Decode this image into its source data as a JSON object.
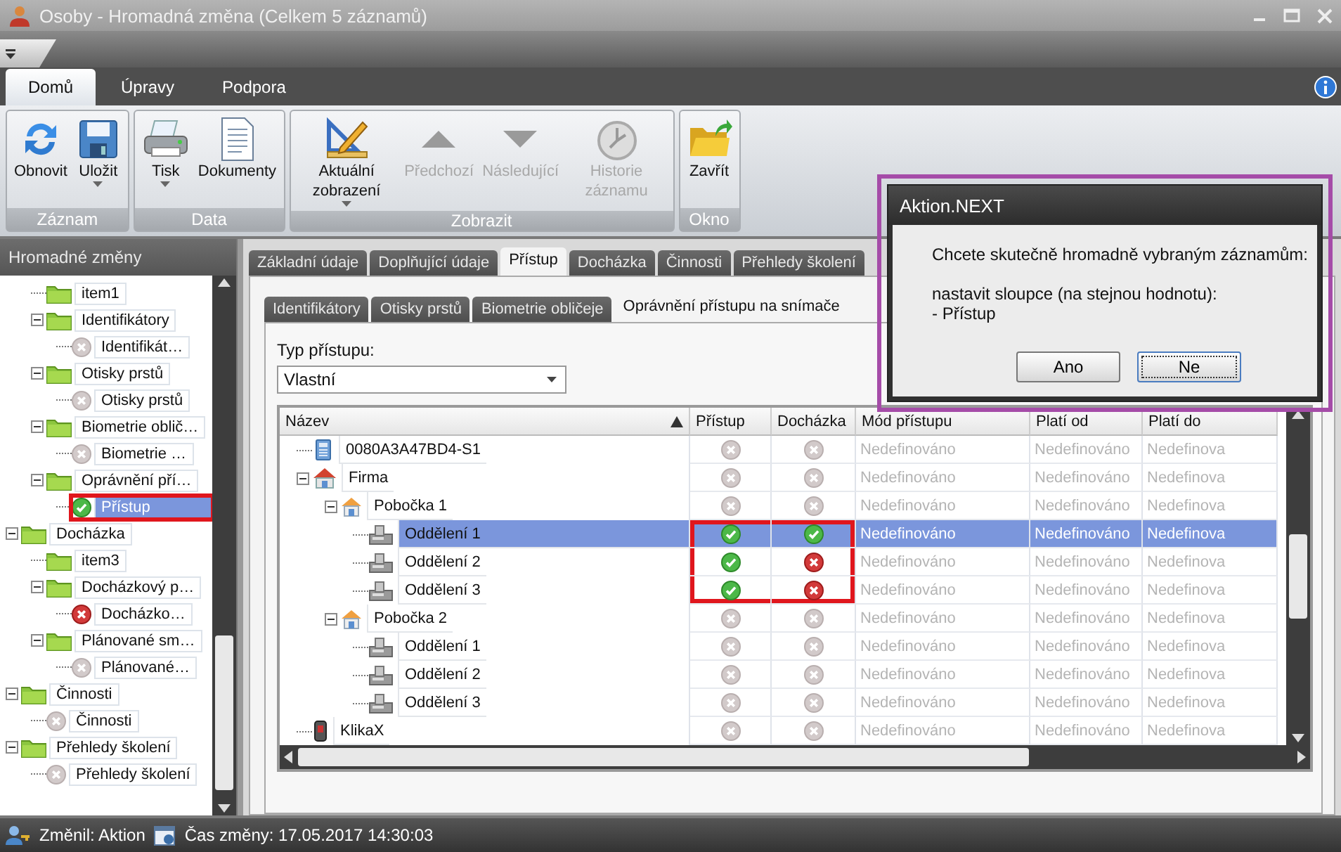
{
  "window": {
    "title": "Osoby - Hromadná změna (Celkem 5 záznamů)"
  },
  "ribbon": {
    "tabs": [
      {
        "label": "Domů",
        "selected": true
      },
      {
        "label": "Úpravy",
        "selected": false
      },
      {
        "label": "Podpora",
        "selected": false
      }
    ],
    "groups": [
      {
        "label": "Záznam",
        "buttons": [
          {
            "label": "Obnovit",
            "kind": "refresh",
            "dropdown": false,
            "disabled": false
          },
          {
            "label": "Uložit",
            "kind": "save",
            "dropdown": true,
            "disabled": false
          }
        ]
      },
      {
        "label": "Data",
        "buttons": [
          {
            "label": "Tisk",
            "kind": "print",
            "dropdown": true,
            "disabled": false
          },
          {
            "label": "Dokumenty",
            "kind": "document",
            "dropdown": false,
            "disabled": false
          }
        ]
      },
      {
        "label": "Zobrazit",
        "buttons": [
          {
            "label": "Aktuální zobrazení",
            "kind": "ruler",
            "dropdown": true,
            "disabled": false
          },
          {
            "label": "Předchozí",
            "kind": "up",
            "dropdown": false,
            "disabled": true
          },
          {
            "label": "Následující",
            "kind": "down",
            "dropdown": false,
            "disabled": true
          },
          {
            "label": "Historie záznamu",
            "kind": "clock",
            "dropdown": false,
            "disabled": true
          }
        ]
      },
      {
        "label": "Okno",
        "buttons": [
          {
            "label": "Zavřít",
            "kind": "folder",
            "dropdown": false,
            "disabled": false
          }
        ]
      }
    ]
  },
  "sidebar": {
    "title": "Hromadné změny",
    "tree": [
      {
        "children": [
          {
            "label": "item1",
            "kind": "folder",
            "selected": false
          },
          {
            "label": "Identifikátory",
            "kind": "folder",
            "selected": false,
            "expanded": true,
            "children": [
              {
                "label": "Identifikát…",
                "kind": "unset",
                "selected": false,
                "highlighted": false
              }
            ]
          },
          {
            "label": "Otisky prstů",
            "kind": "folder",
            "selected": false,
            "expanded": true,
            "children": [
              {
                "label": "Otisky prstů",
                "kind": "unset",
                "selected": false,
                "highlighted": false
              }
            ]
          },
          {
            "label": "Biometrie oblič…",
            "kind": "folder",
            "selected": false,
            "expanded": true,
            "children": [
              {
                "label": "Biometrie …",
                "kind": "unset",
                "selected": false,
                "highlighted": false
              }
            ]
          },
          {
            "label": "Oprávnění pří…",
            "kind": "folder",
            "selected": false,
            "expanded": true,
            "children": [
              {
                "label": "Přístup",
                "kind": "allowed",
                "selected": true,
                "highlighted": true
              }
            ]
          }
        ]
      },
      {
        "label": "Docházka",
        "kind": "folder",
        "selected": false,
        "expanded": true,
        "children": [
          {
            "label": "item3",
            "kind": "folder",
            "selected": false
          },
          {
            "label": "Docházkový p…",
            "kind": "folder",
            "selected": false,
            "expanded": true,
            "children": [
              {
                "label": "Docházko…",
                "kind": "denied",
                "selected": false,
                "highlighted": false
              }
            ]
          },
          {
            "label": "Plánované sm…",
            "kind": "folder",
            "selected": false,
            "expanded": true,
            "children": [
              {
                "label": "Plánované…",
                "kind": "unset",
                "selected": false,
                "highlighted": false
              }
            ]
          }
        ]
      },
      {
        "label": "Činnosti",
        "kind": "folder",
        "selected": false,
        "expanded": true,
        "children": [
          {
            "label": "Činnosti",
            "kind": "unset",
            "selected": false,
            "highlighted": false
          }
        ]
      },
      {
        "label": "Přehledy školení",
        "kind": "folder",
        "selected": false,
        "expanded": true,
        "children": [
          {
            "label": "Přehledy školení",
            "kind": "unset",
            "selected": false,
            "highlighted": false
          }
        ]
      }
    ]
  },
  "tabs": [
    {
      "label": "Základní údaje",
      "selected": false
    },
    {
      "label": "Doplňující údaje",
      "selected": false
    },
    {
      "label": "Přístup",
      "selected": true
    },
    {
      "label": "Docházka",
      "selected": false
    },
    {
      "label": "Činnosti",
      "selected": false
    },
    {
      "label": "Přehledy školení",
      "selected": false
    }
  ],
  "subtabs": [
    {
      "label": "Identifikátory",
      "selected": false
    },
    {
      "label": "Otisky prstů",
      "selected": false
    },
    {
      "label": "Biometrie obličeje",
      "selected": false
    },
    {
      "label": "Oprávnění přístupu na snímače",
      "selected": true
    }
  ],
  "access_type": {
    "label": "Typ přístupu:",
    "value": "Vlastní"
  },
  "table": {
    "columns": [
      "Název",
      "Přístup",
      "Docházka",
      "Mód přístupu",
      "Platí od",
      "Platí do"
    ],
    "rows": [
      {
        "children": [
          {
            "name": "0080A3A47BD4-S1",
            "kind": "device",
            "access": {
              "kind": "unset"
            },
            "attendance": {
              "kind": "unset"
            },
            "mode": "Nedefinováno",
            "from": "Nedefinováno",
            "to": "Nedefinova",
            "selected": false,
            "highlighted": false
          },
          {
            "name": "Firma",
            "kind": "company",
            "access": {
              "kind": "unset"
            },
            "attendance": {
              "kind": "unset"
            },
            "mode": "Nedefinováno",
            "from": "Nedefinováno",
            "to": "Nedefinova",
            "selected": false,
            "highlighted": false,
            "expanded": true,
            "children": [
              {
                "name": "Pobočka 1",
                "kind": "branch",
                "access": {
                  "kind": "unset"
                },
                "attendance": {
                  "kind": "unset"
                },
                "mode": "Nedefinováno",
                "from": "Nedefinováno",
                "to": "Nedefinova",
                "selected": false,
                "highlighted": false,
                "expanded": true,
                "children": [
                  {
                    "name": "Oddělení 1",
                    "kind": "department",
                    "access": {
                      "kind": "allowed"
                    },
                    "attendance": {
                      "kind": "allowed"
                    },
                    "mode": "Nedefinováno",
                    "from": "Nedefinováno",
                    "to": "Nedefinova",
                    "selected": true,
                    "highlighted": true
                  },
                  {
                    "name": "Oddělení 2",
                    "kind": "department",
                    "access": {
                      "kind": "allowed"
                    },
                    "attendance": {
                      "kind": "denied"
                    },
                    "mode": "Nedefinováno",
                    "from": "Nedefinováno",
                    "to": "Nedefinova",
                    "selected": false,
                    "highlighted": true
                  },
                  {
                    "name": "Oddělení 3",
                    "kind": "department",
                    "access": {
                      "kind": "allowed"
                    },
                    "attendance": {
                      "kind": "denied"
                    },
                    "mode": "Nedefinováno",
                    "from": "Nedefinováno",
                    "to": "Nedefinova",
                    "selected": false,
                    "highlighted": true
                  }
                ]
              },
              {
                "name": "Pobočka 2",
                "kind": "branch",
                "access": {
                  "kind": "unset"
                },
                "attendance": {
                  "kind": "unset"
                },
                "mode": "Nedefinováno",
                "from": "Nedefinováno",
                "to": "Nedefinova",
                "selected": false,
                "highlighted": false,
                "expanded": true,
                "children": [
                  {
                    "name": "Oddělení 1",
                    "kind": "department",
                    "access": {
                      "kind": "unset"
                    },
                    "attendance": {
                      "kind": "unset"
                    },
                    "mode": "Nedefinováno",
                    "from": "Nedefinováno",
                    "to": "Nedefinova",
                    "selected": false,
                    "highlighted": false
                  },
                  {
                    "name": "Oddělení 2",
                    "kind": "department",
                    "access": {
                      "kind": "unset"
                    },
                    "attendance": {
                      "kind": "unset"
                    },
                    "mode": "Nedefinováno",
                    "from": "Nedefinováno",
                    "to": "Nedefinova",
                    "selected": false,
                    "highlighted": false
                  },
                  {
                    "name": "Oddělení 3",
                    "kind": "department",
                    "access": {
                      "kind": "unset"
                    },
                    "attendance": {
                      "kind": "unset"
                    },
                    "mode": "Nedefinováno",
                    "from": "Nedefinováno",
                    "to": "Nedefinova",
                    "selected": false,
                    "highlighted": false
                  }
                ]
              }
            ]
          },
          {
            "name": "KlikaX",
            "kind": "handle",
            "access": {
              "kind": "unset"
            },
            "attendance": {
              "kind": "unset"
            },
            "mode": "Nedefinováno",
            "from": "Nedefinováno",
            "to": "Nedefinova",
            "selected": false,
            "highlighted": false
          }
        ]
      }
    ]
  },
  "status_bar": {
    "changed_by": "Změnil: Aktion",
    "changed_at": "Čas změny: 17.05.2017 14:30:03"
  },
  "dialog": {
    "title": "Aktion.NEXT",
    "highlighted": true,
    "message": [
      "Chcete skutečně hromadně vybraným záznamům:",
      "nastavit sloupce (na stejnou hodnotu):",
      "- Přístup"
    ],
    "buttons": [
      {
        "label": "Ano",
        "focused": false
      },
      {
        "label": "Ne",
        "focused": true
      }
    ]
  }
}
